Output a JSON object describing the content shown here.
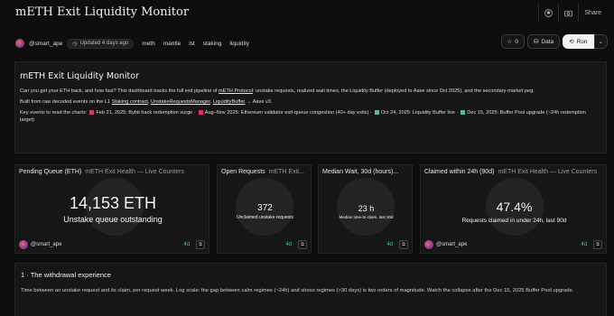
{
  "header": {
    "title": "mETH Exit Liquidity Monitor",
    "share_label": "Share"
  },
  "meta": {
    "author": "@smart_ape",
    "updated": "Updated 4 days ago",
    "tags": [
      "meth",
      "mantle",
      "lst",
      "staking",
      "liquidity"
    ]
  },
  "actions": {
    "star_count": "0",
    "data_label": "Data",
    "run_label": "Run"
  },
  "intro": {
    "title": "mETH Exit Liquidity Monitor",
    "p1_pre": "Can you get your ETH back, and how fast? This dashboard tracks the full exit pipeline of ",
    "p1_link": "mETH Protocol",
    "p1_post": ": unstake requests, realized wait times, the Liquidity Buffer (deployed to Aave since Oct 2025), and the secondary-market peg.",
    "p2_pre": "Built from raw decoded events on the L1 ",
    "p2_link1": "Staking contract",
    "p2_sep1": ", ",
    "p2_link2": "UnstakeRequestsManager",
    "p2_sep2": ", ",
    "p2_link3": "LiquidityBuffer",
    "p2_post": " → Aave v3.",
    "events_prefix": "Key events to read the charts:",
    "events": [
      {
        "color": "#e0315b",
        "label": "Feb 21, 2025: Bybit hack redemption surge ·"
      },
      {
        "color": "#e0315b",
        "label": "Aug–Nov 2025: Ethereum validator exit-queue congestion (40+ day exits) ·"
      },
      {
        "color": "#4fc08d",
        "label": "Oct 24, 2025: Liquidity Buffer live ·"
      },
      {
        "color": "#4fc08d",
        "label": "Dec 15, 2025: Buffer Pool upgrade"
      }
    ],
    "events_suffix": "(~24h redemption target)"
  },
  "panels": [
    {
      "title": "Pending Queue (ETH)",
      "subtitle": "mETH Exit Health — Live Counters",
      "value": "14,153 ETH",
      "caption": "Unstake queue outstanding",
      "author": "@smart_ape",
      "age": "4d"
    },
    {
      "title": "Open Requests",
      "subtitle": "mETH Exit...",
      "value": "372",
      "caption": "Unclaimed unstake requests",
      "author": "@smart_ape",
      "age": "4d"
    },
    {
      "title": "Median Wait, 30d (hours)...",
      "subtitle": "",
      "value": "23 h",
      "caption": "Median time-to-claim, last 30d",
      "author": "@smart_ape",
      "age": "4d"
    },
    {
      "title": "Claimed within 24h (90d)",
      "subtitle": "mETH Exit Health — Live Counters",
      "value": "47.4%",
      "caption": "Requests claimed in under 24h, last 90d",
      "author": "@smart_ape",
      "age": "4d"
    }
  ],
  "section": {
    "title": "1 · The withdrawal experience",
    "text": "Time between an unstake request and its claim, per request week. Log scale: the gap between calm regimes (~24h) and stress regimes (>30 days) is two orders of magnitude. Watch the collapse after the Dec 15, 2025 Buffer Pool upgrade."
  }
}
